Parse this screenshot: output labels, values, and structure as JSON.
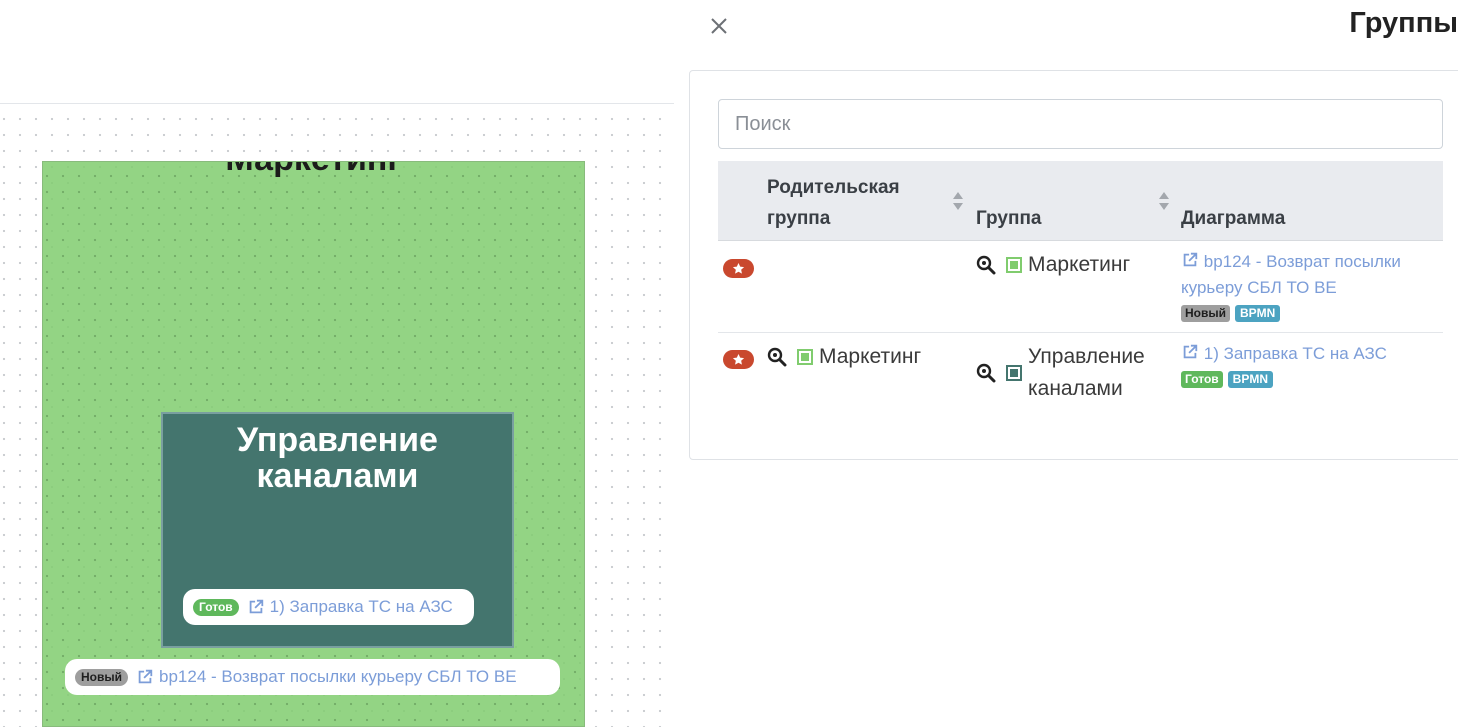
{
  "canvas": {
    "outer_group": {
      "title": "Маркетинг",
      "color": "#80cc6e",
      "chip": {
        "badge": "Новый",
        "link": "bp124 - Возврат посылки курьеру СБЛ ТО ВЕ"
      }
    },
    "inner_group": {
      "title": "Управление каналами",
      "color": "#44756e",
      "chip": {
        "badge": "Готов",
        "link": "1) Заправка ТС на АЗС"
      }
    }
  },
  "panel": {
    "title": "Группы",
    "search_placeholder": "Поиск",
    "columns": {
      "parent": "Родительская группа",
      "group": "Группа",
      "diagram": "Диаграмма"
    },
    "rows": [
      {
        "parent": "",
        "group": "Маркетинг",
        "group_color": "#80cc6e",
        "diagram_link": "bp124 - Возврат посылки курьеру СБЛ ТО ВЕ",
        "status": "Новый",
        "type": "BPMN"
      },
      {
        "parent": "Маркетинг",
        "parent_color": "#80cc6e",
        "group": "Управление каналами",
        "group_color": "#44756e",
        "diagram_link": "1) Заправка ТС на АЗС",
        "status": "Готов",
        "type": "BPMN"
      }
    ]
  },
  "colors": {
    "favorite": "#c9482e",
    "link": "#7c9dd8",
    "badge_new": "#9e9e9e",
    "badge_ready": "#5fb85c",
    "badge_bpmn": "#4ca3c1"
  }
}
